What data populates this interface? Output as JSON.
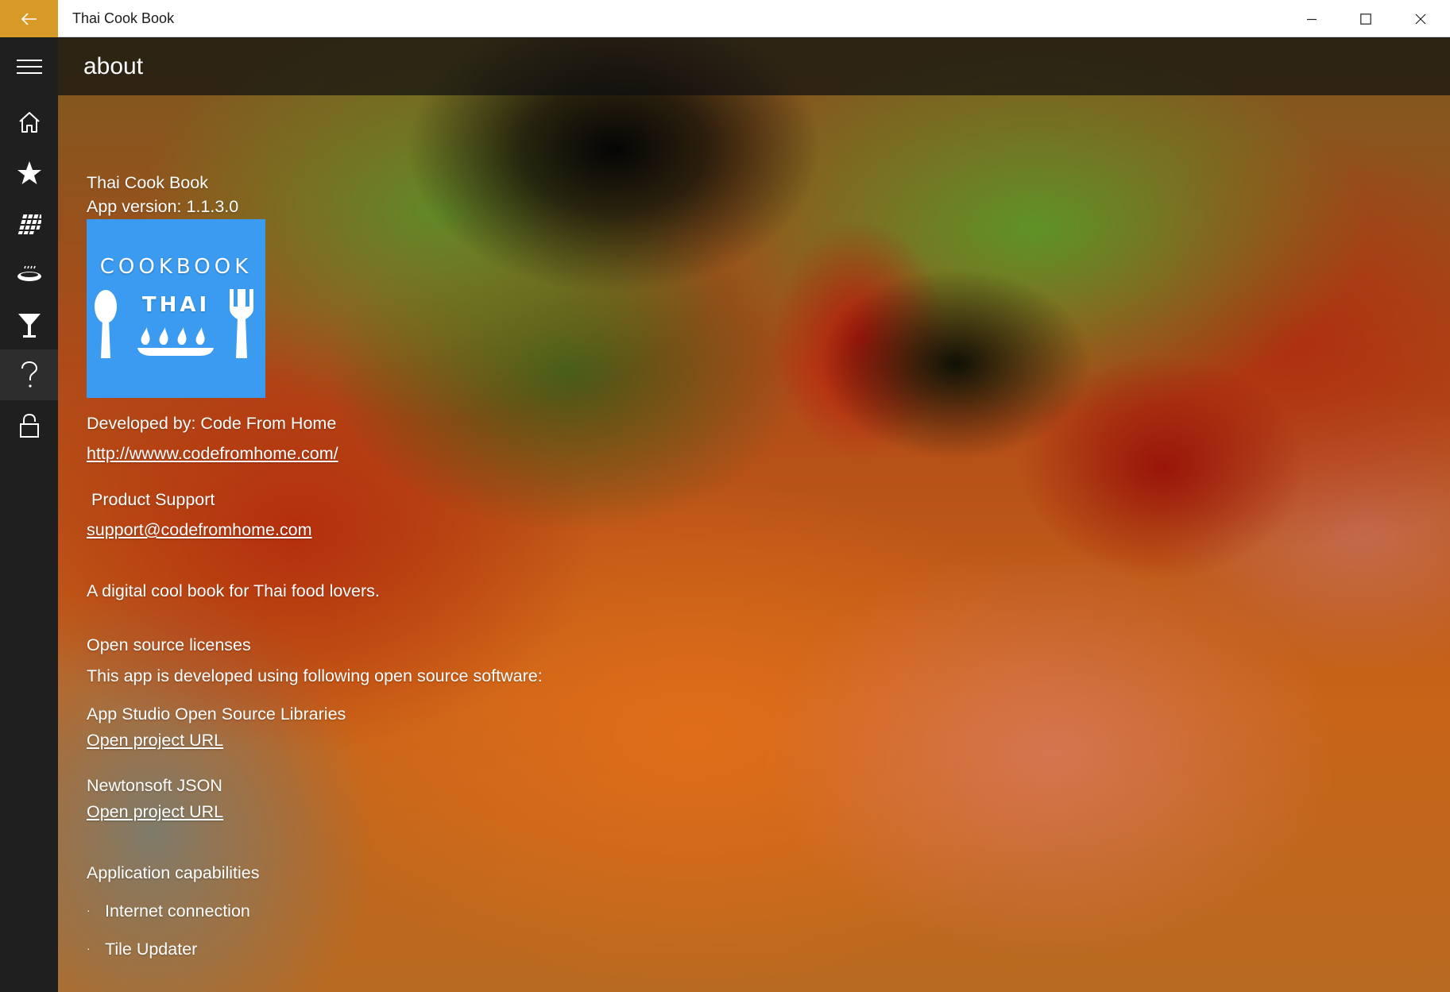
{
  "window": {
    "app_title": "Thai Cook Book",
    "accent_color": "#d89a26"
  },
  "nav": {
    "items": [
      {
        "icon": "home-icon"
      },
      {
        "icon": "star-icon"
      },
      {
        "icon": "grid-icon"
      },
      {
        "icon": "dish-icon"
      },
      {
        "icon": "cocktail-glass-icon"
      },
      {
        "icon": "help-icon",
        "selected": true
      },
      {
        "icon": "lock-icon"
      }
    ]
  },
  "header": {
    "title": "about"
  },
  "about": {
    "app_name": "Thai Cook Book",
    "version": "App version: 1.1.3.0",
    "logo": {
      "line1": "COOKBOOK",
      "line2": "THAI",
      "color": "#3a9bf0"
    },
    "developer": "Developed by: Code From Home",
    "website": "http://wwww.codefromhome.com/",
    "support_label": "Product Support",
    "support_email": "support@codefromhome.com",
    "description": "A digital cool book for Thai food lovers.",
    "licenses_title": "Open source licenses",
    "licenses_intro": "This app is developed using following open source software:",
    "libraries": [
      {
        "name": "App Studio Open Source Libraries",
        "link": "Open project URL"
      },
      {
        "name": "Newtonsoft JSON",
        "link": "Open project URL"
      }
    ],
    "capabilities_title": "Application capabilities",
    "capabilities": [
      "Internet connection",
      "Tile Updater"
    ]
  }
}
